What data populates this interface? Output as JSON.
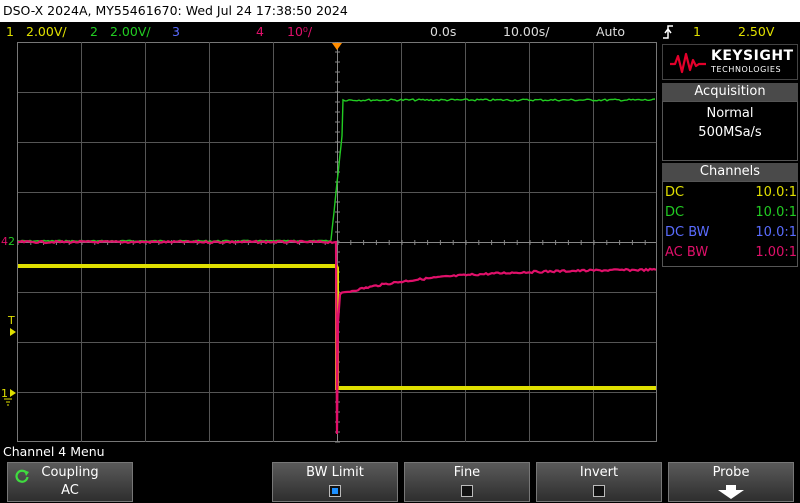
{
  "title": "DSO-X 2024A, MY55461670: Wed Jul 24 17:38:50 2024",
  "status": {
    "ch1_num": "1",
    "ch1_scale": "2.00V/",
    "ch2_num": "2",
    "ch2_scale": "2.00V/",
    "ch3_num": "3",
    "ch4_num": "4",
    "ch4_scale": "10⁰/",
    "delay": "0.0s",
    "timebase": "10.00s/",
    "trigger_mode": "Auto",
    "trig_icon": "trigger-edge-icon",
    "trig_ch": "1",
    "trig_level": "2.50V"
  },
  "brand": {
    "name": "KEYSIGHT",
    "sub": "TECHNOLOGIES",
    "icon": "keysight-wave-logo"
  },
  "acquisition": {
    "header": "Acquisition",
    "mode": "Normal",
    "rate": "500MSa/s"
  },
  "channels": {
    "header": "Channels",
    "rows": [
      {
        "coupling": "DC",
        "probe": "10.0:1",
        "color": "#e0e000"
      },
      {
        "coupling": "DC",
        "probe": "10.0:1",
        "color": "#22cc22"
      },
      {
        "coupling": "DC BW",
        "probe": "10.0:1",
        "color": "#5a6cff"
      },
      {
        "coupling": "AC BW",
        "probe": "1.00:1",
        "color": "#e0106a"
      }
    ]
  },
  "markers": {
    "ch4_ground": "4",
    "ch2_ground": "2",
    "trig_level": "T",
    "ch1_ground": "1"
  },
  "menu": {
    "title": "Channel 4 Menu",
    "coupling_label": "Coupling",
    "coupling_value": "AC",
    "bwlimit_label": "BW Limit",
    "bwlimit_checked": true,
    "fine_label": "Fine",
    "fine_checked": false,
    "invert_label": "Invert",
    "invert_checked": false,
    "probe_label": "Probe"
  },
  "colors": {
    "ch1": "#e0e000",
    "ch2": "#22cc22",
    "ch3": "#5a6cff",
    "ch4": "#e0106a",
    "trigger_marker": "#ff8c00",
    "grid": "#5a5a5a"
  }
}
